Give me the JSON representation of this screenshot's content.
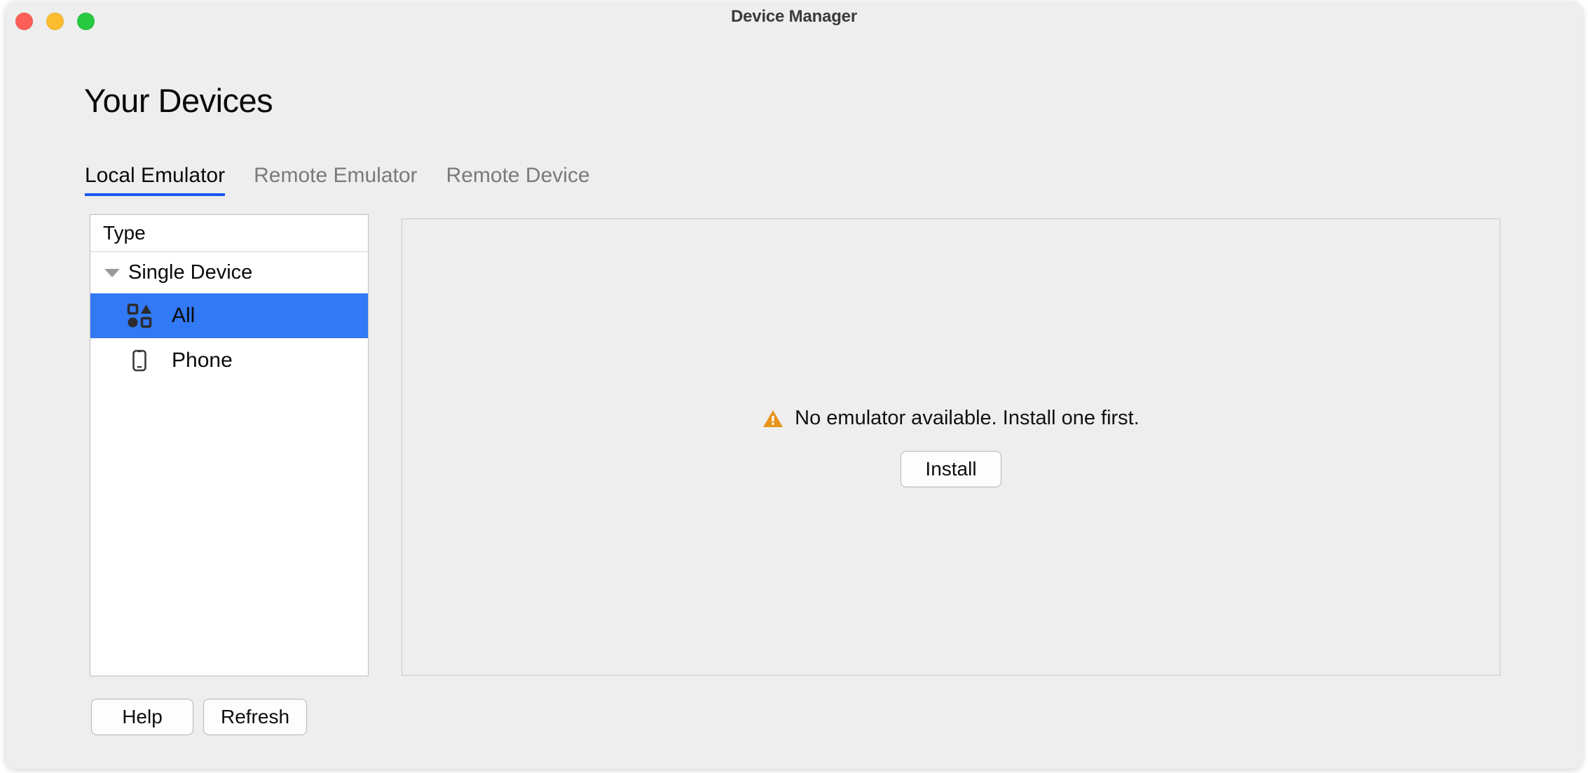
{
  "window": {
    "title": "Device Manager",
    "traffic_lights": [
      {
        "name": "close",
        "color": "#fc5f57"
      },
      {
        "name": "minimize",
        "color": "#fbbd2e"
      },
      {
        "name": "maximize",
        "color": "#26c940"
      }
    ]
  },
  "page": {
    "title": "Your Devices"
  },
  "tabs": [
    {
      "label": "Local Emulator",
      "active": true
    },
    {
      "label": "Remote Emulator",
      "active": false
    },
    {
      "label": "Remote Device",
      "active": false
    }
  ],
  "tree": {
    "header": "Type",
    "group": {
      "label": "Single Device",
      "expanded": true,
      "disclosure_icon": "triangle-down-icon"
    },
    "items": [
      {
        "label": "All",
        "icon": "shapes-grid-icon",
        "selected": true
      },
      {
        "label": "Phone",
        "icon": "phone-icon",
        "selected": false
      }
    ]
  },
  "content": {
    "empty_state": {
      "icon": "warning-triangle-icon",
      "message": "No emulator available. Install one first.",
      "install_label": "Install"
    }
  },
  "footer": {
    "help_label": "Help",
    "refresh_label": "Refresh"
  },
  "colors": {
    "accent_blue": "#1a56f0",
    "selection_blue": "#3179f5",
    "warning_amber": "#e8941a",
    "window_bg": "#eeeeee",
    "panel_bg": "#ffffff"
  }
}
